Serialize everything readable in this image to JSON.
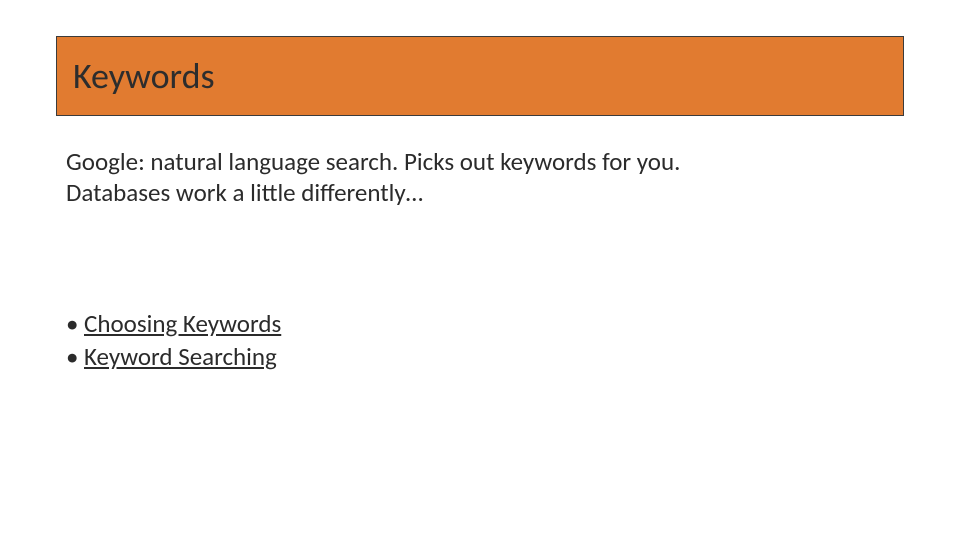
{
  "title": "Keywords",
  "intro_line1": "Google: natural language search. Picks out keywords for you.",
  "intro_line2": "Databases work a little differently…",
  "bullets": {
    "b1_marker": "•",
    "b1_label": "Choosing Keywords",
    "b2_marker": "•",
    "b2_label": "Keyword Searching"
  }
}
